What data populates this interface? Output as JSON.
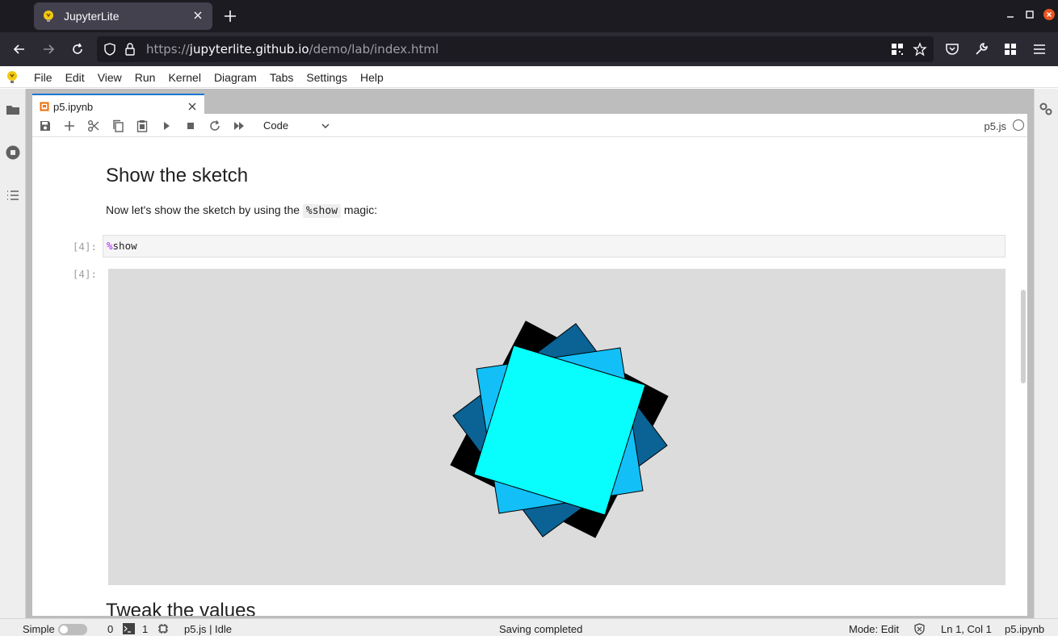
{
  "browser": {
    "tab_title": "JupyterLite",
    "url_prefix": "https://",
    "url_host": "jupyterlite.github.io",
    "url_path": "/demo/lab/index.html"
  },
  "menu": {
    "items": [
      "File",
      "Edit",
      "View",
      "Run",
      "Kernel",
      "Diagram",
      "Tabs",
      "Settings",
      "Help"
    ]
  },
  "notebook": {
    "tab_label": "p5.ipynb",
    "cell_type": "Code",
    "kernel_name": "p5.js",
    "heading": "Show the sketch",
    "paragraph_before": "Now let's show the sketch by using the ",
    "paragraph_code": "%show",
    "paragraph_after": " magic:",
    "input_prompt": "[4]:",
    "input_magic_sign": "%",
    "input_code": "show",
    "output_prompt": "[4]:",
    "next_heading": "Tweak the values",
    "canvas_colors": {
      "background": "#dcdcdc",
      "square_1": "#000000",
      "square_2": "#0a6394",
      "square_3": "#12c0f7",
      "square_4": "#08fdfd"
    }
  },
  "statusbar": {
    "mode_label": "Simple",
    "terminals": "0",
    "kernels": "1",
    "kernel_status": "p5.js | Idle",
    "message": "Saving completed",
    "mode": "Mode: Edit",
    "cursor": "Ln 1, Col 1",
    "file": "p5.ipynb"
  }
}
